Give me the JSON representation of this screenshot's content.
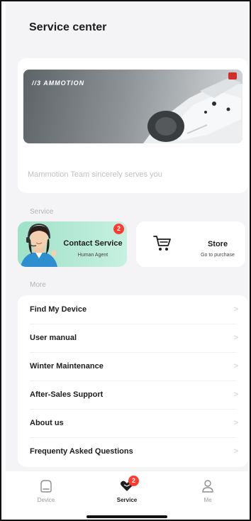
{
  "header": {
    "title": "Service center"
  },
  "banner": {
    "brand": "AMMOTION",
    "slogan": "Mammotion Team sincerely serves you"
  },
  "service_section": {
    "label": "Service",
    "contact": {
      "title": "Contact Service",
      "subtitle": "Human Agent",
      "badge": "2",
      "icon": "agent-avatar"
    },
    "store": {
      "title": "Store",
      "subtitle": "Go to purchase",
      "icon": "cart-icon"
    }
  },
  "more_section": {
    "label": "More",
    "items": [
      {
        "label": "Find My Device",
        "chevron": ">"
      },
      {
        "label": "User manual",
        "chevron": ">"
      },
      {
        "label": "Winter Maintenance",
        "chevron": ">"
      },
      {
        "label": "After-Sales Support",
        "chevron": ">"
      },
      {
        "label": "About us",
        "chevron": ">"
      },
      {
        "label": "Frequenty Asked Questions",
        "chevron": ">"
      }
    ]
  },
  "tabbar": {
    "tabs": [
      {
        "label": "Device",
        "icon": "device-icon",
        "active": false
      },
      {
        "label": "Service",
        "icon": "service-heart-icon",
        "active": true,
        "badge": "2"
      },
      {
        "label": "Me",
        "icon": "person-icon",
        "active": false
      }
    ]
  },
  "colors": {
    "background": "#f4f4f6",
    "badge": "#ff3b30",
    "contact_card": "#b3ead6",
    "text_primary": "#1d1d1f",
    "text_muted": "#b3b3ba"
  }
}
